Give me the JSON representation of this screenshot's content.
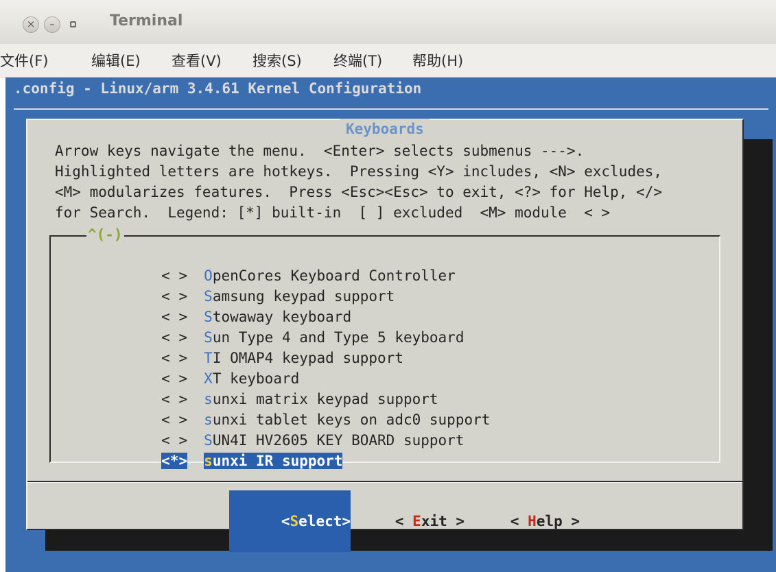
{
  "window": {
    "title": "Terminal",
    "close_glyph": "×",
    "minimize_glyph": "–"
  },
  "menubar": {
    "items": [
      "文件(F)",
      "编辑(E)",
      "查看(V)",
      "搜索(S)",
      "终端(T)",
      "帮助(H)"
    ]
  },
  "terminal": {
    "header": ".config - Linux/arm 3.4.61 Kernel Configuration"
  },
  "dialog": {
    "title": "Keyboards",
    "help_lines": [
      "Arrow keys navigate the menu.  <Enter> selects submenus --->.",
      "Highlighted letters are hotkeys.  Pressing <Y> includes, <N> excludes,",
      "<M> modularizes features.  Press <Esc><Esc> to exit, <?> for Help, </>",
      "for Search.  Legend: [*] built-in  [ ] excluded  <M> module  < >"
    ],
    "scroll_indicator": "^(-)",
    "items": [
      {
        "bracket": "< >",
        "hotkey": "O",
        "rest": "penCores Keyboard Controller"
      },
      {
        "bracket": "< >",
        "hotkey": "S",
        "rest": "amsung keypad support"
      },
      {
        "bracket": "< >",
        "hotkey": "S",
        "rest": "towaway keyboard"
      },
      {
        "bracket": "< >",
        "hotkey": "S",
        "rest": "un Type 4 and Type 5 keyboard"
      },
      {
        "bracket": "< >",
        "hotkey": "T",
        "rest": "I OMAP4 keypad support"
      },
      {
        "bracket": "< >",
        "hotkey": "X",
        "rest": "T keyboard"
      },
      {
        "bracket": "< >",
        "hotkey": "s",
        "rest": "unxi matrix keypad support"
      },
      {
        "bracket": "< >",
        "hotkey": "s",
        "rest": "unxi tablet keys on adc0 support"
      },
      {
        "bracket": "< >",
        "hotkey": "S",
        "rest": "UN4I HV2605 KEY BOARD support"
      },
      {
        "bracket": "<*>",
        "hotkey": "s",
        "rest": "unxi IR support"
      }
    ],
    "selected_index": 9,
    "buttons": {
      "select": {
        "open": "<",
        "hotkey": "S",
        "rest": "elect",
        "close": ">"
      },
      "exit": {
        "open": "< ",
        "hotkey": "E",
        "rest": "xit",
        "close": " >"
      },
      "help": {
        "open": "< ",
        "hotkey": "H",
        "rest": "elp",
        "close": " >"
      }
    }
  },
  "colors": {
    "terminal_bg": "#3a6eb0",
    "dialog_bg": "#d4d4cc",
    "hotkey_blue": "#3d72c0",
    "selection_bg": "#2a5fae",
    "selection_hotkey": "#f0ce4c",
    "button_hotkey": "#c62a1e",
    "scroll_indicator": "#8aa832"
  }
}
